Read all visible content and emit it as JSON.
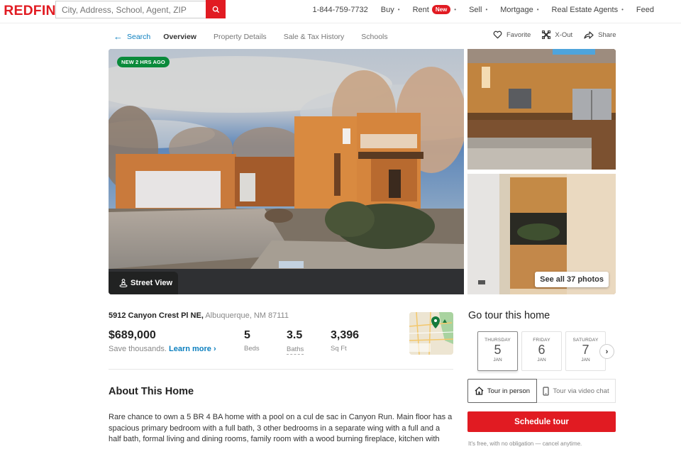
{
  "header": {
    "logo": "REDFIN",
    "search_placeholder": "City, Address, School, Agent, ZIP",
    "phone": "1-844-759-7732",
    "nav": [
      {
        "label": "Buy"
      },
      {
        "label": "Rent",
        "badge": "New"
      },
      {
        "label": "Sell"
      },
      {
        "label": "Mortgage"
      },
      {
        "label": "Real Estate Agents"
      }
    ],
    "feed": "Feed",
    "brand_color": "#e11b22"
  },
  "subnav": {
    "back": "Search",
    "tabs": [
      "Overview",
      "Property Details",
      "Sale & Tax History",
      "Schools"
    ],
    "active_tab": "Overview"
  },
  "actions": {
    "favorite": "Favorite",
    "xout": "X-Out",
    "share": "Share"
  },
  "photos": {
    "badge": "NEW 2 HRS AGO",
    "street_view": "Street View",
    "see_all": "See all 37 photos"
  },
  "listing": {
    "street": "5912 Canyon Crest Pl NE,",
    "city": "Albuquerque, NM 87111",
    "price": "$689,000",
    "save_text": "Save thousands.",
    "learn_more": "Learn more",
    "stats": [
      {
        "value": "5",
        "label": "Beds"
      },
      {
        "value": "3.5",
        "label": "Baths"
      },
      {
        "value": "3,396",
        "label": "Sq Ft"
      }
    ]
  },
  "about": {
    "title": "About This Home",
    "text": "Rare chance to own a 5 BR 4 BA home with a pool on a cul de sac in Canyon Run. Main floor has a spacious primary bedroom with a full bath, 3 other bedrooms in a separate wing with a full and a half bath, formal living and dining rooms, family room with a wood burning fireplace, kitchen with"
  },
  "tour": {
    "title": "Go tour this home",
    "dates": [
      {
        "dow": "THURSDAY",
        "day": "5",
        "month": "JAN",
        "selected": true
      },
      {
        "dow": "FRIDAY",
        "day": "6",
        "month": "JAN",
        "selected": false
      },
      {
        "dow": "SATURDAY",
        "day": "7",
        "month": "JAN",
        "selected": false
      }
    ],
    "in_person": "Tour in person",
    "video": "Tour via video chat",
    "schedule": "Schedule tour",
    "note": "It's free, with no obligation — cancel anytime."
  }
}
